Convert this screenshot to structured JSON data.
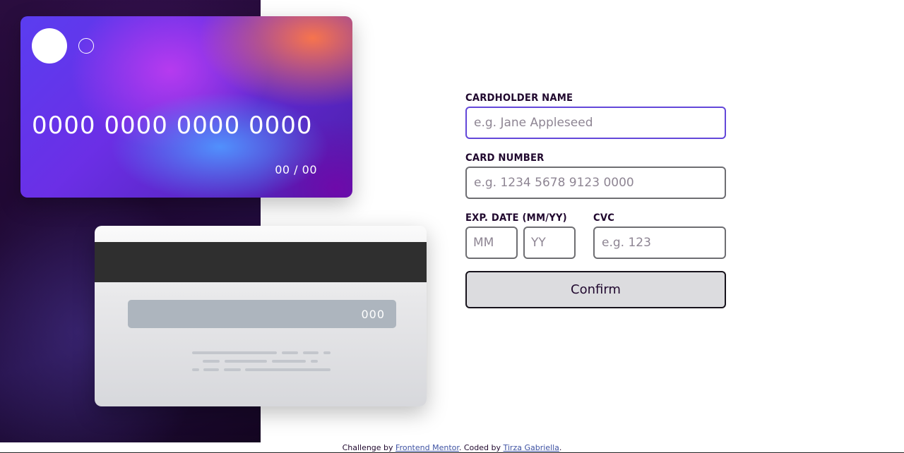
{
  "card_front": {
    "number": "0000 0000 0000 0000",
    "expiry": "00 / 00"
  },
  "card_back": {
    "cvc": "000"
  },
  "form": {
    "cardholder_label": "CARDHOLDER NAME",
    "cardholder_placeholder": "e.g. Jane Appleseed",
    "cardholder_value": "",
    "number_label": "CARD NUMBER",
    "number_placeholder": "e.g. 1234 5678 9123 0000",
    "number_value": "",
    "exp_label": "EXP. DATE (MM/YY)",
    "exp_month_placeholder": "MM",
    "exp_year_placeholder": "YY",
    "cvc_label": "CVC",
    "cvc_placeholder": "e.g. 123",
    "confirm_label": "Confirm"
  },
  "footer": {
    "prefix": "Challenge by ",
    "link1": "Frontend Mentor",
    "middle": ". Coded by ",
    "link2": "Tirza Gabriella",
    "suffix": "."
  },
  "colors": {
    "accent": "#6347d9",
    "text": "#21092f",
    "border": "#6e6e72"
  }
}
